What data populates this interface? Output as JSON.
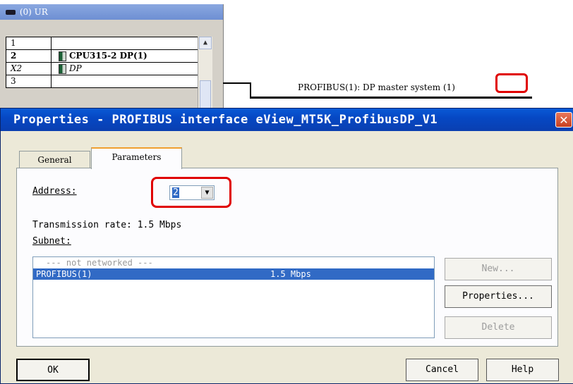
{
  "rack": {
    "title": "(0) UR",
    "rows": [
      {
        "slot": "1",
        "module": ""
      },
      {
        "slot": "2",
        "module": "CPU315-2 DP(1)"
      },
      {
        "slot": "X2",
        "module": "DP"
      },
      {
        "slot": "3",
        "module": ""
      }
    ]
  },
  "bus": {
    "label": "PROFIBUS(1): DP master system",
    "number": "(1)"
  },
  "dialog": {
    "title": "Properties - PROFIBUS interface  eView_MT5K_ProfibusDP_V1",
    "close_glyph": "✕",
    "tabs": [
      "General",
      "Parameters"
    ],
    "address_label": "Address:",
    "address_value": "2",
    "transmission_rate": "Transmission rate: 1.5 Mbps",
    "subnet_label": "Subnet:",
    "subnets": [
      {
        "name": "--- not networked ---",
        "rate": ""
      },
      {
        "name": "PROFIBUS(1)",
        "rate": "1.5 Mbps"
      }
    ],
    "buttons": {
      "new": "New...",
      "properties": "Properties...",
      "delete": "Delete",
      "ok": "OK",
      "cancel": "Cancel",
      "help": "Help"
    }
  },
  "colors": {
    "title_bar": "#0a48c4",
    "selection": "#316ac5",
    "highlight": "#e00000"
  }
}
